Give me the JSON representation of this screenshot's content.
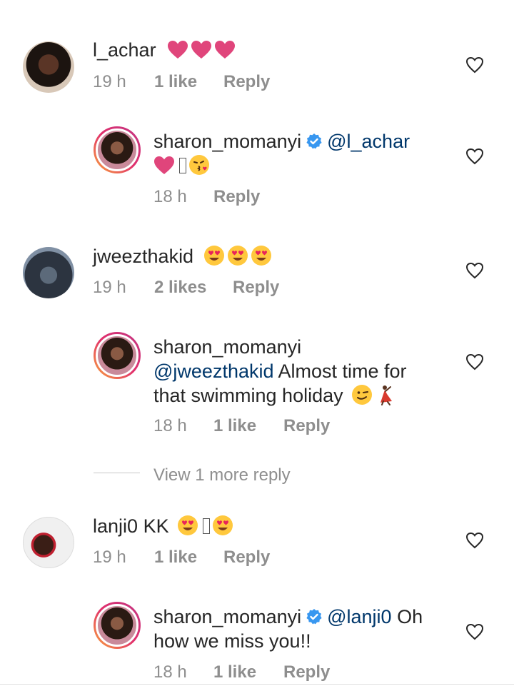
{
  "comments": [
    {
      "username": "l_achar",
      "emojis": [
        "pink-heart",
        "pink-heart",
        "pink-heart"
      ],
      "time": "19 h",
      "likes": "1 like",
      "reply_label": "Reply",
      "reply": {
        "username": "sharon_momanyi",
        "mention": "@l_achar",
        "text_line2": "",
        "time": "18 h",
        "likes": "",
        "reply_label": "Reply"
      }
    },
    {
      "username": "jweezthakid",
      "emojis": [
        "heart-eyes",
        "heart-eyes",
        "heart-eyes"
      ],
      "time": "19 h",
      "likes": "2 likes",
      "reply_label": "Reply",
      "reply": {
        "username": "sharon_momanyi",
        "mention": "@jweezthakid",
        "text_line1": "Almost time for",
        "text_line2": "that swimming holiday",
        "time": "18 h",
        "likes": "1 like",
        "reply_label": "Reply"
      },
      "view_more": "View 1 more reply"
    },
    {
      "username": "lanji0",
      "text": "KK",
      "time": "19 h",
      "likes": "1 like",
      "reply_label": "Reply",
      "reply": {
        "username": "sharon_momanyi",
        "mention": "@lanji0",
        "text_line1": "Oh",
        "text_line2": "how we miss you!!",
        "time": "18 h",
        "likes": "1 like",
        "reply_label": "Reply"
      }
    }
  ],
  "colors": {
    "mention": "#00376b",
    "meta": "#8e8e8e",
    "verified": "#3897f0",
    "pink_heart": "#e0457b"
  }
}
